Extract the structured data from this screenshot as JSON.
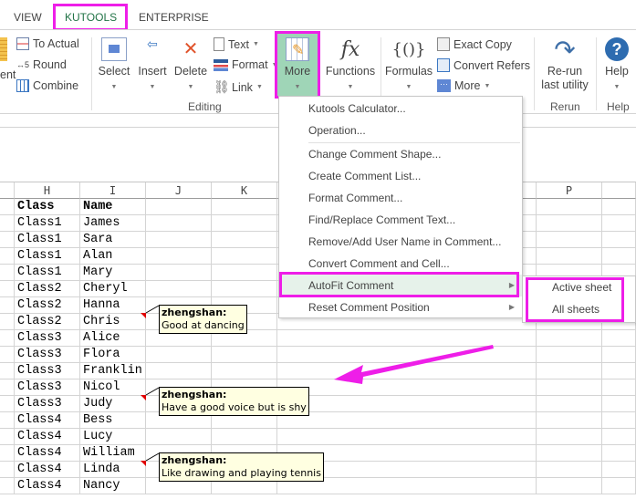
{
  "tabs": [
    {
      "label": "VIEW"
    },
    {
      "label": "KUTOOLS",
      "selected": true
    },
    {
      "label": "ENTERPRISE"
    }
  ],
  "ribbon": {
    "partial_left_label": "ent",
    "range_items": [
      {
        "label": "To Actual",
        "icon": "to-actual-icon"
      },
      {
        "label": "Round",
        "icon": "round-icon"
      },
      {
        "label": "Combine",
        "icon": "combine-icon"
      }
    ],
    "editing": {
      "buttons": [
        {
          "label": "Select",
          "icon": "select-icon"
        },
        {
          "label": "Insert",
          "icon": "insert-icon"
        },
        {
          "label": "Delete",
          "icon": "delete-icon"
        }
      ],
      "small": [
        {
          "label": "Text",
          "icon": "text-icon"
        },
        {
          "label": "Format",
          "icon": "format-icon"
        },
        {
          "label": "Link",
          "icon": "link-icon"
        }
      ],
      "group_label": "Editing"
    },
    "more": {
      "label": "More"
    },
    "functions": {
      "label": "Functions",
      "icon_text": "fx"
    },
    "formulas": {
      "label": "Formulas",
      "icon_text": "{()}"
    },
    "formula_small": [
      {
        "label": "Exact Copy",
        "icon": "exact-copy-icon"
      },
      {
        "label": "Convert Refers",
        "icon": "convert-refers-icon"
      },
      {
        "label": "More",
        "icon": "more-dots-icon"
      }
    ],
    "rerun": {
      "line1": "Re-run",
      "line2": "last utility",
      "group_label": "Rerun"
    },
    "help": {
      "label": "Help",
      "group_label": "Help"
    }
  },
  "sheet": {
    "columns": [
      "H",
      "I",
      "J",
      "K",
      "P"
    ],
    "rows": [
      [
        "Class",
        "Name"
      ],
      [
        "Class1",
        "James"
      ],
      [
        "Class1",
        "Sara"
      ],
      [
        "Class1",
        "Alan"
      ],
      [
        "Class1",
        "Mary"
      ],
      [
        "Class2",
        "Cheryl"
      ],
      [
        "Class2",
        "Hanna"
      ],
      [
        "Class2",
        "Chris"
      ],
      [
        "Class3",
        "Alice"
      ],
      [
        "Class3",
        "Flora"
      ],
      [
        "Class3",
        "Franklin"
      ],
      [
        "Class3",
        "Nicol"
      ],
      [
        "Class3",
        "Judy"
      ],
      [
        "Class4",
        "Bess"
      ],
      [
        "Class4",
        "Lucy"
      ],
      [
        "Class4",
        "William"
      ],
      [
        "Class4",
        "Linda"
      ],
      [
        "Class4",
        "Nancy"
      ]
    ],
    "comments": [
      {
        "author": "zhengshan:",
        "text": "Good at dancing"
      },
      {
        "author": "zhengshan:",
        "text": "Have a good voice but is shy"
      },
      {
        "author": "zhengshan:",
        "text": "Like drawing and playing tennis"
      }
    ]
  },
  "menu": {
    "items": [
      {
        "label": "Kutools Calculator..."
      },
      {
        "label": "Operation..."
      },
      {
        "label": "Change Comment Shape..."
      },
      {
        "label": "Create Comment List..."
      },
      {
        "label": "Format Comment..."
      },
      {
        "label": "Find/Replace Comment Text..."
      },
      {
        "label": "Remove/Add User Name in Comment..."
      },
      {
        "label": "Convert Comment and Cell..."
      },
      {
        "label": "AutoFit Comment",
        "submenu": true,
        "active": true
      },
      {
        "label": "Reset Comment Position",
        "submenu": true
      }
    ],
    "submenu": [
      {
        "label": "Active sheet"
      },
      {
        "label": "All sheets"
      }
    ]
  },
  "colors": {
    "highlight": "#ee1ee8",
    "more_button_bg": "#9fd5b7",
    "accent_green": "#217346"
  }
}
